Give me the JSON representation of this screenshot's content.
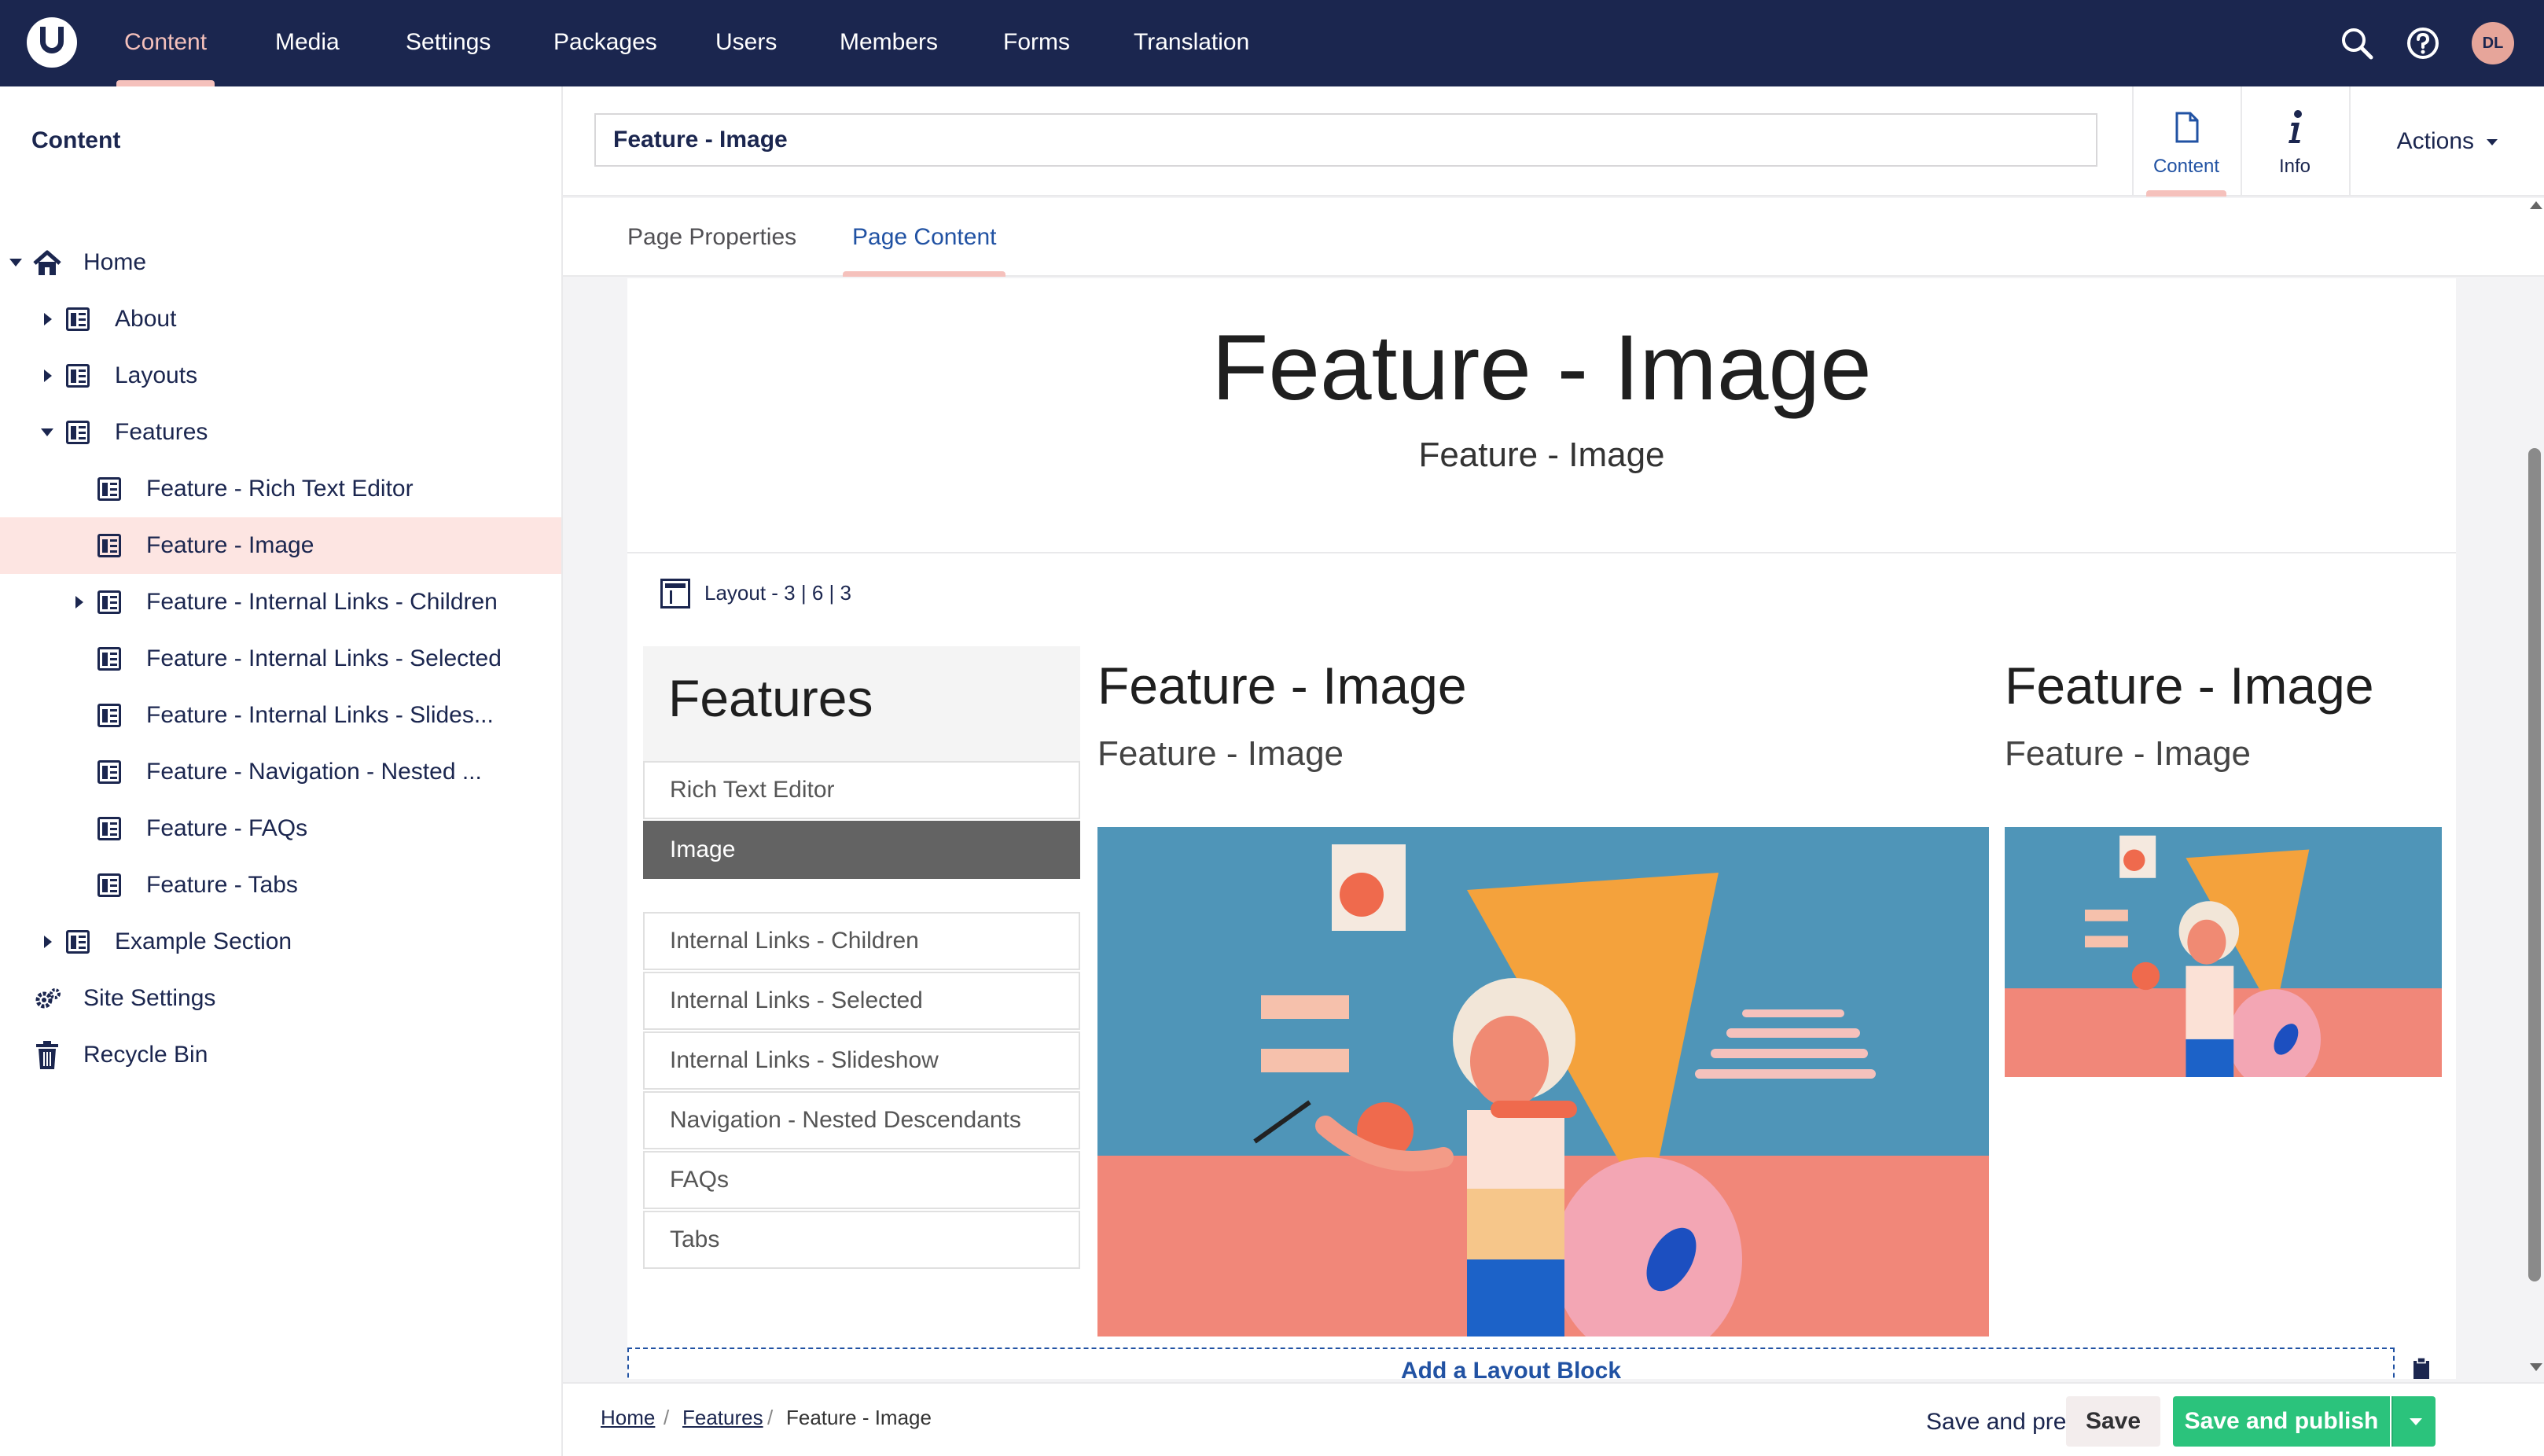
{
  "nav": {
    "items": [
      "Content",
      "Media",
      "Settings",
      "Packages",
      "Users",
      "Members",
      "Forms",
      "Translation"
    ],
    "active": "Content",
    "user_initials": "DL"
  },
  "sidebar": {
    "title": "Content",
    "tree": [
      {
        "label": "Home",
        "icon": "home-icon",
        "caret": "down"
      },
      {
        "label": "About",
        "icon": "document-icon",
        "caret": "right"
      },
      {
        "label": "Layouts",
        "icon": "document-icon",
        "caret": "right"
      },
      {
        "label": "Features",
        "icon": "document-icon",
        "caret": "down"
      },
      {
        "label": "Feature - Rich Text Editor",
        "icon": "document-icon",
        "caret": ""
      },
      {
        "label": "Feature - Image",
        "icon": "document-icon",
        "caret": "",
        "selected": true
      },
      {
        "label": "Feature - Internal Links - Children",
        "icon": "document-icon",
        "caret": "right"
      },
      {
        "label": "Feature - Internal Links - Selected",
        "icon": "document-icon",
        "caret": ""
      },
      {
        "label": "Feature - Internal Links - Slides...",
        "icon": "document-icon",
        "caret": ""
      },
      {
        "label": "Feature - Navigation - Nested ...",
        "icon": "document-icon",
        "caret": ""
      },
      {
        "label": "Feature - FAQs",
        "icon": "document-icon",
        "caret": ""
      },
      {
        "label": "Feature - Tabs",
        "icon": "document-icon",
        "caret": ""
      },
      {
        "label": "Example Section",
        "icon": "document-icon",
        "caret": "right"
      },
      {
        "label": "Site Settings",
        "icon": "settings-icon",
        "caret": ""
      },
      {
        "label": "Recycle Bin",
        "icon": "trash-icon",
        "caret": ""
      }
    ]
  },
  "editor": {
    "name_value": "Feature - Image",
    "apps": [
      {
        "label": "Content",
        "icon": "document-outline-icon"
      },
      {
        "label": "Info",
        "icon": "info-icon"
      }
    ],
    "actions_label": "Actions",
    "tabs": [
      "Page Properties",
      "Page Content"
    ],
    "active_tab": "Page Content"
  },
  "preview": {
    "hero_title": "Feature - Image",
    "hero_subtitle": "Feature - Image",
    "layout_label": "Layout - 3 | 6 | 3",
    "features_heading": "Features",
    "menu_group1": [
      "Rich Text Editor",
      "Image"
    ],
    "menu_active": "Image",
    "menu_group2": [
      "Internal Links - Children",
      "Internal Links - Selected",
      "Internal Links - Slideshow",
      "Navigation - Nested Descendants",
      "FAQs",
      "Tabs"
    ],
    "center_title": "Feature - Image",
    "center_subtitle": "Feature - Image",
    "right_title": "Feature - Image",
    "right_subtitle": "Feature - Image",
    "add_block_label": "Add a Layout Block"
  },
  "footer": {
    "breadcrumb": [
      "Home",
      "Features",
      "Feature - Image"
    ],
    "save_preview_label": "Save and preview",
    "save_label": "Save",
    "publish_label": "Save and publish"
  },
  "colors": {
    "nav_bg": "#1b264f",
    "accent_pink": "#f5c1bc",
    "selected_row": "#fde5e2",
    "publish_green": "#2bc37c",
    "link_blue": "#2152a3"
  }
}
